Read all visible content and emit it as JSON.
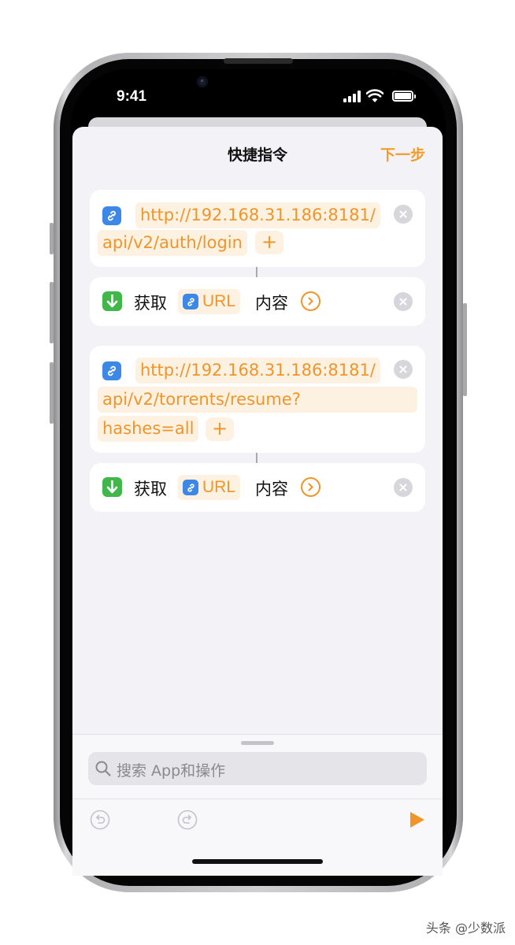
{
  "status_bar": {
    "time": "9:41"
  },
  "nav": {
    "title": "快捷指令",
    "next_label": "下一步"
  },
  "actions": [
    {
      "type": "url",
      "lines": [
        "http://192.168.31.186:8181/",
        "api/v2/auth/login"
      ],
      "add_label": "+"
    },
    {
      "type": "get_contents",
      "verb": "获取",
      "param": "URL",
      "suffix": "内容"
    },
    {
      "type": "url",
      "lines": [
        "http://192.168.31.186:8181/",
        "api/v2/torrents/resume?",
        "hashes=all"
      ],
      "add_label": "+"
    },
    {
      "type": "get_contents",
      "verb": "获取",
      "param": "URL",
      "suffix": "内容"
    }
  ],
  "search": {
    "placeholder": "搜索 App和操作"
  },
  "toolbar": {
    "undo": "undo-icon",
    "redo": "redo-icon",
    "run": "play-icon"
  },
  "colors": {
    "accent": "#f0952a",
    "link_blue": "#3d88e6",
    "get_green": "#40b64b",
    "sheet_bg": "#f2f2f7"
  },
  "watermark": "头条 @少数派"
}
